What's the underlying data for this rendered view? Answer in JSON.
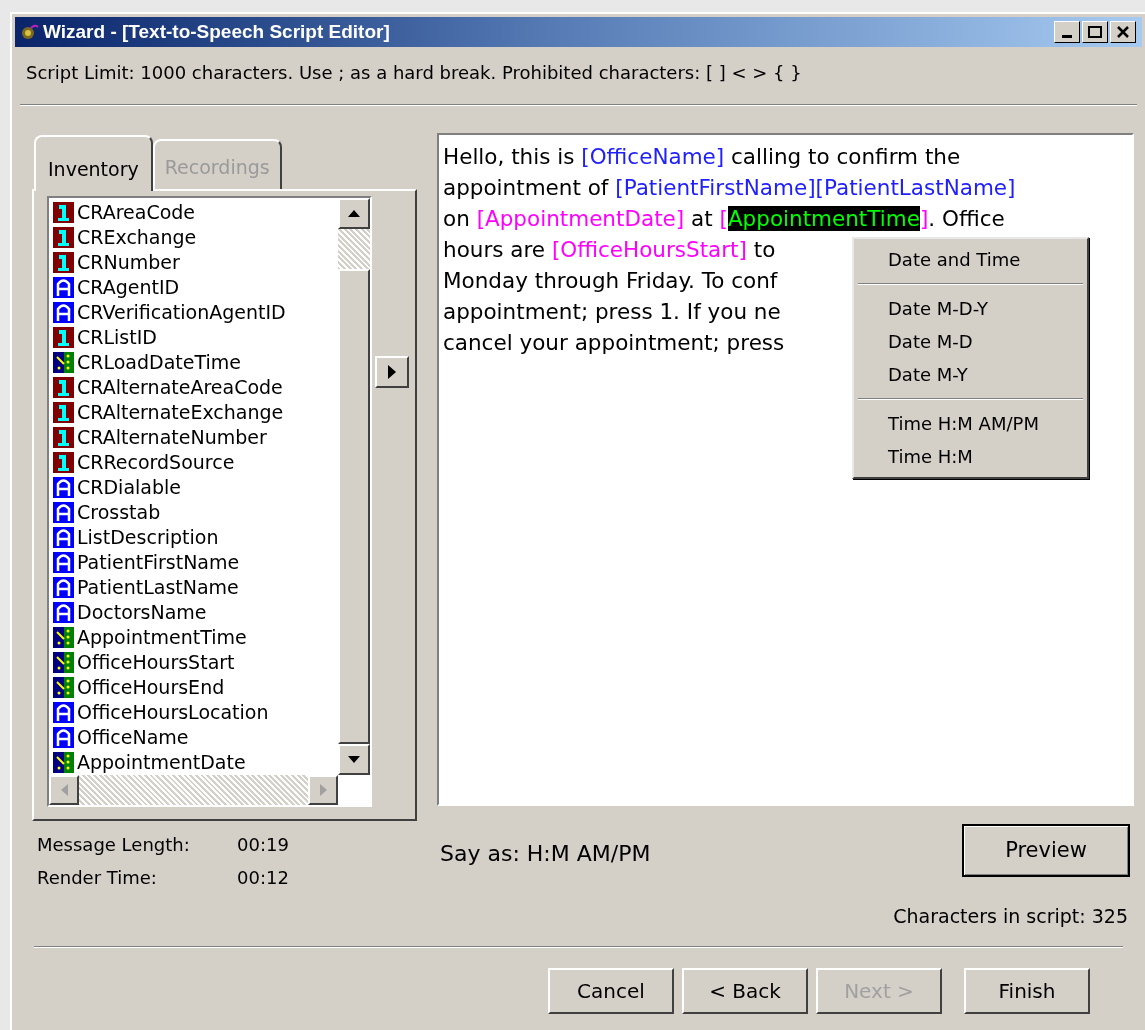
{
  "window": {
    "title": "Wizard - [Text-to-Speech Script Editor]"
  },
  "instructions": "Script Limit: 1000 characters. Use ; as a hard break. Prohibited characters: [ ] < > { }",
  "tabs": [
    {
      "label": "Inventory",
      "selected": true
    },
    {
      "label": "Recordings",
      "selected": false
    }
  ],
  "fields": [
    {
      "name": "CRAreaCode",
      "kind": "number"
    },
    {
      "name": "CRExchange",
      "kind": "number"
    },
    {
      "name": "CRNumber",
      "kind": "number"
    },
    {
      "name": "CRAgentID",
      "kind": "text"
    },
    {
      "name": "CRVerificationAgentID",
      "kind": "text"
    },
    {
      "name": "CRListID",
      "kind": "number"
    },
    {
      "name": "CRLoadDateTime",
      "kind": "datetime"
    },
    {
      "name": "CRAlternateAreaCode",
      "kind": "number"
    },
    {
      "name": "CRAlternateExchange",
      "kind": "number"
    },
    {
      "name": "CRAlternateNumber",
      "kind": "number"
    },
    {
      "name": "CRRecordSource",
      "kind": "number"
    },
    {
      "name": "CRDialable",
      "kind": "text"
    },
    {
      "name": "Crosstab",
      "kind": "text"
    },
    {
      "name": "ListDescription",
      "kind": "text"
    },
    {
      "name": "PatientFirstName",
      "kind": "text"
    },
    {
      "name": "PatientLastName",
      "kind": "text"
    },
    {
      "name": "DoctorsName",
      "kind": "text"
    },
    {
      "name": "AppointmentTime",
      "kind": "datetime"
    },
    {
      "name": "OfficeHoursStart",
      "kind": "datetime"
    },
    {
      "name": "OfficeHoursEnd",
      "kind": "datetime"
    },
    {
      "name": "OfficeHoursLocation",
      "kind": "text"
    },
    {
      "name": "OfficeName",
      "kind": "text"
    },
    {
      "name": "AppointmentDate",
      "kind": "datetime"
    }
  ],
  "script_lines": [
    [
      {
        "kind": "plain",
        "text": "Hello, this is "
      },
      {
        "kind": "text_field",
        "text": "[OfficeName]"
      },
      {
        "kind": "plain",
        "text": " calling to confirm the"
      }
    ],
    [
      {
        "kind": "plain",
        "text": "appointment of "
      },
      {
        "kind": "text_field",
        "text": "[PatientFirstName][PatientLastName]"
      }
    ],
    [
      {
        "kind": "plain",
        "text": "on "
      },
      {
        "kind": "date_field",
        "text": "[AppointmentDate]"
      },
      {
        "kind": "plain",
        "text": " at "
      },
      {
        "kind": "date_field",
        "text": "["
      },
      {
        "kind": "selected",
        "text": "AppointmentTime"
      },
      {
        "kind": "date_field",
        "text": "]"
      },
      {
        "kind": "plain",
        "text": ". Office"
      }
    ],
    [
      {
        "kind": "plain",
        "text": "hours are "
      },
      {
        "kind": "date_field",
        "text": "[OfficeHoursStart]"
      },
      {
        "kind": "plain",
        "text": " to"
      }
    ],
    [
      {
        "kind": "plain",
        "text": "Monday through Friday. To conf"
      }
    ],
    [
      {
        "kind": "plain",
        "text": "appointment; press 1. If you ne"
      }
    ],
    [
      {
        "kind": "plain",
        "text": "cancel your appointment; press"
      }
    ]
  ],
  "context_menu": [
    {
      "kind": "item",
      "label": "Date and Time"
    },
    {
      "kind": "separator"
    },
    {
      "kind": "item",
      "label": "Date M-D-Y"
    },
    {
      "kind": "item",
      "label": "Date M-D"
    },
    {
      "kind": "item",
      "label": "Date M-Y"
    },
    {
      "kind": "separator"
    },
    {
      "kind": "item",
      "label": "Time H:M AM/PM"
    },
    {
      "kind": "item",
      "label": "Time H:M"
    }
  ],
  "stats": [
    {
      "label": "Message Length:",
      "value": "00:19"
    },
    {
      "label": "Render Time:",
      "value": "00:12"
    }
  ],
  "say_as": "Say as: H:M AM/PM",
  "preview_button": "Preview",
  "char_count": "Characters in script: 325",
  "buttons": [
    {
      "label": "Cancel",
      "disabled": false
    },
    {
      "label": "< Back",
      "disabled": false
    },
    {
      "label": "Next >",
      "disabled": true
    },
    {
      "label": "Finish",
      "disabled": false
    }
  ]
}
